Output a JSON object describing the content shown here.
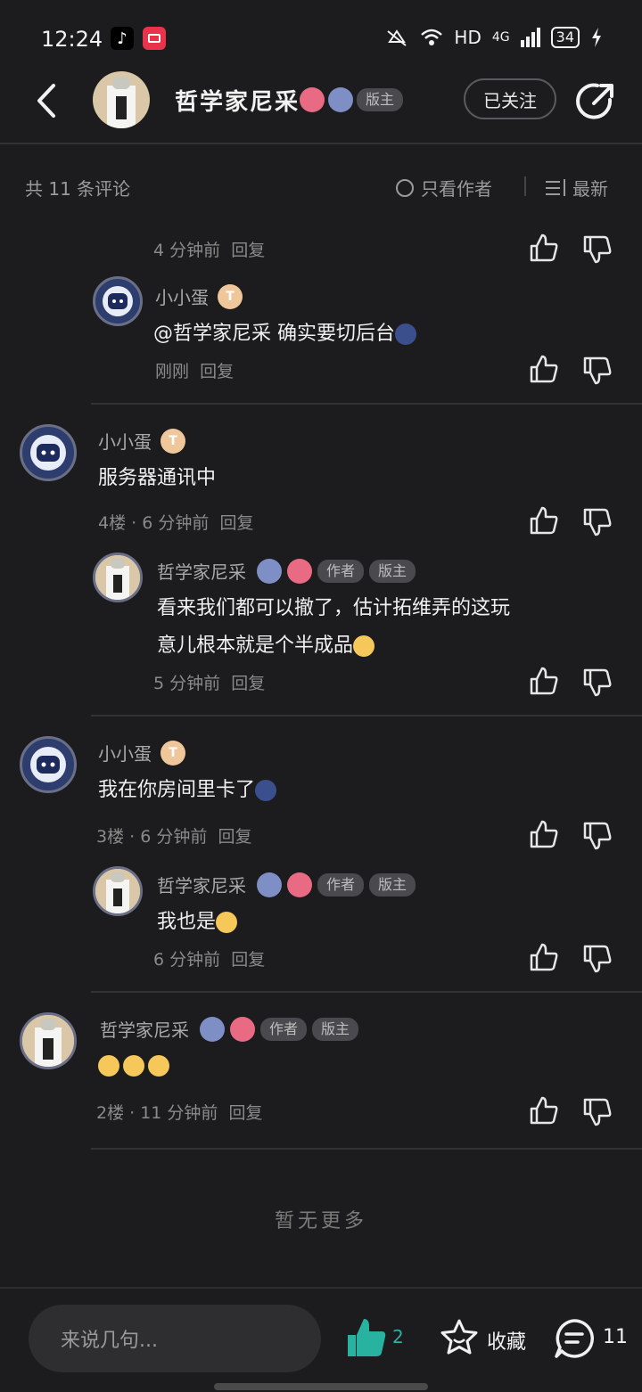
{
  "status_bar": {
    "time": "12:24",
    "network": "HD",
    "signal": "4G",
    "battery": "34"
  },
  "header": {
    "title": "哲学家尼采",
    "role_badge": "版主",
    "follow_label": "已关注"
  },
  "filter": {
    "count_label": "共 11 条评论",
    "author_only": "只看作者",
    "sort_label": "最新"
  },
  "comments": [
    {
      "meta": "4 分钟前",
      "reply": "回复"
    },
    {
      "name": "小小蛋",
      "text": "@哲学家尼采  确实要切后台",
      "meta": "刚刚",
      "reply": "回复"
    },
    {
      "name": "小小蛋",
      "text": "服务器通讯中",
      "meta": "4楼 · 6 分钟前",
      "reply": "回复"
    },
    {
      "name": "哲学家尼采",
      "tag_author": "作者",
      "tag_mod": "版主",
      "text1": "看来我们都可以撤了，估计拓维弄的这玩",
      "text2": "意儿根本就是个半成品",
      "meta": "5 分钟前",
      "reply": "回复"
    },
    {
      "name": "小小蛋",
      "text": "我在你房间里卡了",
      "meta": "3楼 · 6 分钟前",
      "reply": "回复"
    },
    {
      "name": "哲学家尼采",
      "tag_author": "作者",
      "tag_mod": "版主",
      "text": "我也是",
      "meta": "6 分钟前",
      "reply": "回复"
    },
    {
      "name": "哲学家尼采",
      "tag_author": "作者",
      "tag_mod": "版主",
      "meta": "2楼 · 11 分钟前",
      "reply": "回复"
    }
  ],
  "footer": {
    "no_more": "暂无更多"
  },
  "bottom": {
    "placeholder": "来说几句...",
    "like_count": "2",
    "fav_label": "收藏",
    "comment_count": "11"
  },
  "colors": {
    "background": "#1c1c1e",
    "accent_like": "#27b3a0"
  }
}
